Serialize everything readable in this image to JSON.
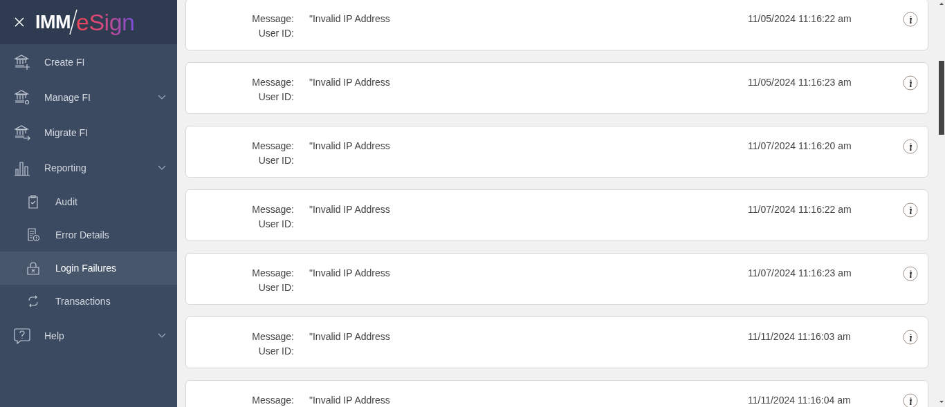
{
  "logo": {
    "left": "IMM",
    "right": "eSign"
  },
  "sidebar": {
    "items": [
      {
        "label": "Create FI",
        "kind": "link"
      },
      {
        "label": "Manage FI",
        "kind": "group"
      },
      {
        "label": "Migrate FI",
        "kind": "link"
      },
      {
        "label": "Reporting",
        "kind": "group",
        "children": [
          {
            "label": "Audit",
            "selected": false
          },
          {
            "label": "Error Details",
            "selected": false
          },
          {
            "label": "Login Failures",
            "selected": true
          },
          {
            "label": "Transactions",
            "selected": false
          }
        ]
      },
      {
        "label": "Help",
        "kind": "group"
      }
    ]
  },
  "records": [
    {
      "message_label": "Message:",
      "message": "\"Invalid IP Address",
      "user_label": "User ID:",
      "time": "11/05/2024 11:16:22 am"
    },
    {
      "message_label": "Message:",
      "message": "\"Invalid IP Address",
      "user_label": "User ID:",
      "time": "11/05/2024 11:16:23 am"
    },
    {
      "message_label": "Message:",
      "message": "\"Invalid IP Address",
      "user_label": "User ID:",
      "time": "11/07/2024 11:16:20 am"
    },
    {
      "message_label": "Message:",
      "message": "\"Invalid IP Address",
      "user_label": "User ID:",
      "time": "11/07/2024 11:16:22 am"
    },
    {
      "message_label": "Message:",
      "message": "\"Invalid IP Address",
      "user_label": "User ID:",
      "time": "11/07/2024 11:16:23 am"
    },
    {
      "message_label": "Message:",
      "message": "\"Invalid IP Address",
      "user_label": "User ID:",
      "time": "11/11/2024 11:16:03 am"
    },
    {
      "message_label": "Message:",
      "message": "\"Invalid IP Address",
      "time": "11/11/2024 11:16:04 am"
    }
  ]
}
